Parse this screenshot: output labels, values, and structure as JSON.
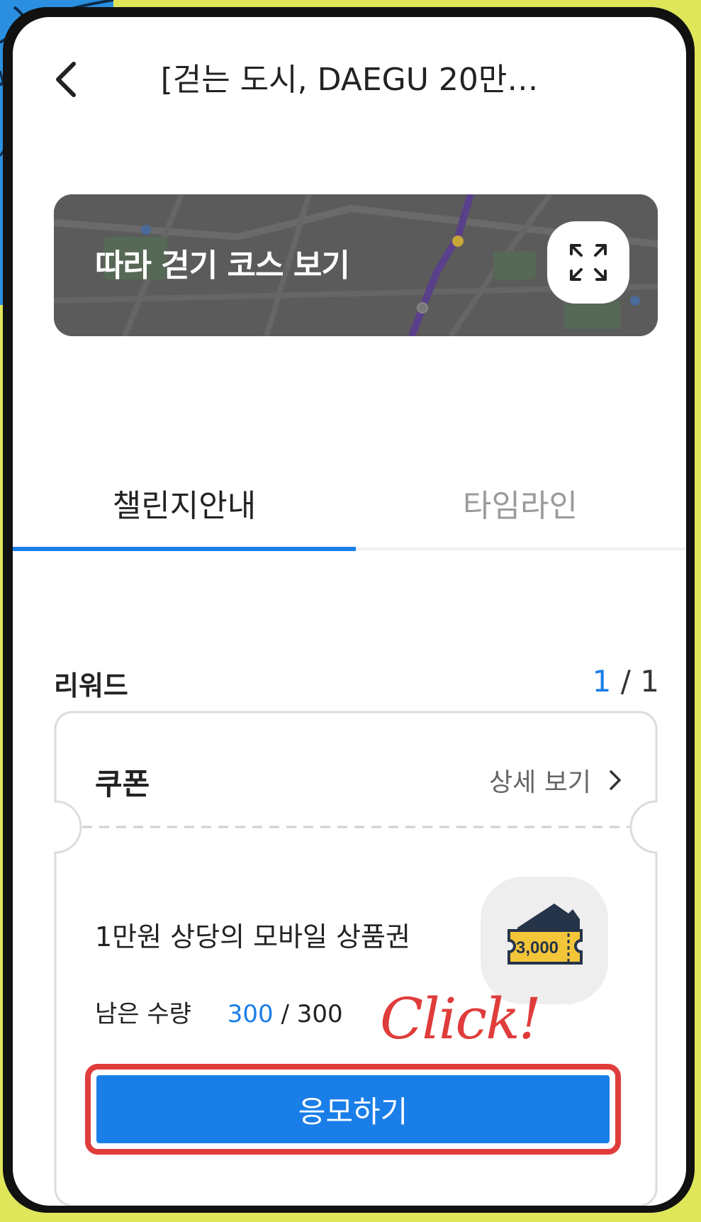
{
  "header": {
    "title": "[걷는 도시, DAEGU 20만…"
  },
  "course_banner": {
    "label": "따라 걷기 코스 보기",
    "expand_icon": "expand-icon"
  },
  "tabs": [
    {
      "label": "챌린지안내",
      "active": true
    },
    {
      "label": "타임라인",
      "active": false
    }
  ],
  "reward": {
    "title": "리워드",
    "page_current": "1",
    "page_total": "/ 1",
    "coupon": {
      "name": "쿠폰",
      "detail_label": "상세 보기",
      "prize": "1만원 상당의 모바일 상품권",
      "remaining_label": "남은 수량",
      "remaining_current": "300",
      "remaining_total": "/ 300",
      "voucher_amount": "3,000",
      "apply_label": "응모하기"
    }
  },
  "annotation": {
    "click_label": "Click!",
    "highlight_color": "#e03c3c"
  },
  "colors": {
    "accent": "#1a7ee8",
    "background": "#dfe65a"
  }
}
